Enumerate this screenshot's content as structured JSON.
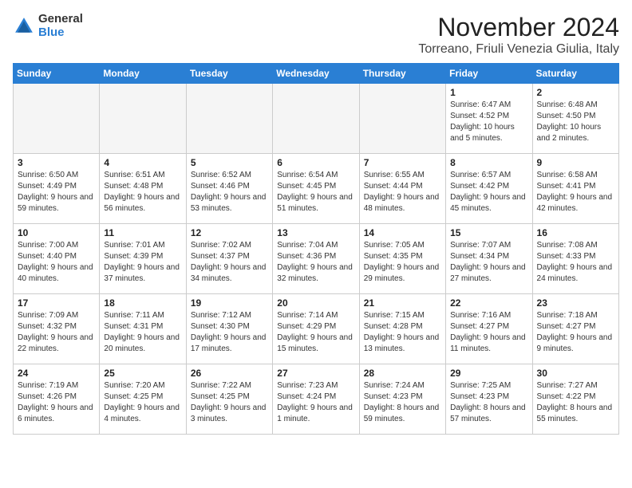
{
  "logo": {
    "general": "General",
    "blue": "Blue"
  },
  "title": "November 2024",
  "location": "Torreano, Friuli Venezia Giulia, Italy",
  "weekdays": [
    "Sunday",
    "Monday",
    "Tuesday",
    "Wednesday",
    "Thursday",
    "Friday",
    "Saturday"
  ],
  "weeks": [
    [
      {
        "day": "",
        "info": ""
      },
      {
        "day": "",
        "info": ""
      },
      {
        "day": "",
        "info": ""
      },
      {
        "day": "",
        "info": ""
      },
      {
        "day": "",
        "info": ""
      },
      {
        "day": "1",
        "info": "Sunrise: 6:47 AM\nSunset: 4:52 PM\nDaylight: 10 hours and 5 minutes."
      },
      {
        "day": "2",
        "info": "Sunrise: 6:48 AM\nSunset: 4:50 PM\nDaylight: 10 hours and 2 minutes."
      }
    ],
    [
      {
        "day": "3",
        "info": "Sunrise: 6:50 AM\nSunset: 4:49 PM\nDaylight: 9 hours and 59 minutes."
      },
      {
        "day": "4",
        "info": "Sunrise: 6:51 AM\nSunset: 4:48 PM\nDaylight: 9 hours and 56 minutes."
      },
      {
        "day": "5",
        "info": "Sunrise: 6:52 AM\nSunset: 4:46 PM\nDaylight: 9 hours and 53 minutes."
      },
      {
        "day": "6",
        "info": "Sunrise: 6:54 AM\nSunset: 4:45 PM\nDaylight: 9 hours and 51 minutes."
      },
      {
        "day": "7",
        "info": "Sunrise: 6:55 AM\nSunset: 4:44 PM\nDaylight: 9 hours and 48 minutes."
      },
      {
        "day": "8",
        "info": "Sunrise: 6:57 AM\nSunset: 4:42 PM\nDaylight: 9 hours and 45 minutes."
      },
      {
        "day": "9",
        "info": "Sunrise: 6:58 AM\nSunset: 4:41 PM\nDaylight: 9 hours and 42 minutes."
      }
    ],
    [
      {
        "day": "10",
        "info": "Sunrise: 7:00 AM\nSunset: 4:40 PM\nDaylight: 9 hours and 40 minutes."
      },
      {
        "day": "11",
        "info": "Sunrise: 7:01 AM\nSunset: 4:39 PM\nDaylight: 9 hours and 37 minutes."
      },
      {
        "day": "12",
        "info": "Sunrise: 7:02 AM\nSunset: 4:37 PM\nDaylight: 9 hours and 34 minutes."
      },
      {
        "day": "13",
        "info": "Sunrise: 7:04 AM\nSunset: 4:36 PM\nDaylight: 9 hours and 32 minutes."
      },
      {
        "day": "14",
        "info": "Sunrise: 7:05 AM\nSunset: 4:35 PM\nDaylight: 9 hours and 29 minutes."
      },
      {
        "day": "15",
        "info": "Sunrise: 7:07 AM\nSunset: 4:34 PM\nDaylight: 9 hours and 27 minutes."
      },
      {
        "day": "16",
        "info": "Sunrise: 7:08 AM\nSunset: 4:33 PM\nDaylight: 9 hours and 24 minutes."
      }
    ],
    [
      {
        "day": "17",
        "info": "Sunrise: 7:09 AM\nSunset: 4:32 PM\nDaylight: 9 hours and 22 minutes."
      },
      {
        "day": "18",
        "info": "Sunrise: 7:11 AM\nSunset: 4:31 PM\nDaylight: 9 hours and 20 minutes."
      },
      {
        "day": "19",
        "info": "Sunrise: 7:12 AM\nSunset: 4:30 PM\nDaylight: 9 hours and 17 minutes."
      },
      {
        "day": "20",
        "info": "Sunrise: 7:14 AM\nSunset: 4:29 PM\nDaylight: 9 hours and 15 minutes."
      },
      {
        "day": "21",
        "info": "Sunrise: 7:15 AM\nSunset: 4:28 PM\nDaylight: 9 hours and 13 minutes."
      },
      {
        "day": "22",
        "info": "Sunrise: 7:16 AM\nSunset: 4:27 PM\nDaylight: 9 hours and 11 minutes."
      },
      {
        "day": "23",
        "info": "Sunrise: 7:18 AM\nSunset: 4:27 PM\nDaylight: 9 hours and 9 minutes."
      }
    ],
    [
      {
        "day": "24",
        "info": "Sunrise: 7:19 AM\nSunset: 4:26 PM\nDaylight: 9 hours and 6 minutes."
      },
      {
        "day": "25",
        "info": "Sunrise: 7:20 AM\nSunset: 4:25 PM\nDaylight: 9 hours and 4 minutes."
      },
      {
        "day": "26",
        "info": "Sunrise: 7:22 AM\nSunset: 4:25 PM\nDaylight: 9 hours and 3 minutes."
      },
      {
        "day": "27",
        "info": "Sunrise: 7:23 AM\nSunset: 4:24 PM\nDaylight: 9 hours and 1 minute."
      },
      {
        "day": "28",
        "info": "Sunrise: 7:24 AM\nSunset: 4:23 PM\nDaylight: 8 hours and 59 minutes."
      },
      {
        "day": "29",
        "info": "Sunrise: 7:25 AM\nSunset: 4:23 PM\nDaylight: 8 hours and 57 minutes."
      },
      {
        "day": "30",
        "info": "Sunrise: 7:27 AM\nSunset: 4:22 PM\nDaylight: 8 hours and 55 minutes."
      }
    ]
  ]
}
